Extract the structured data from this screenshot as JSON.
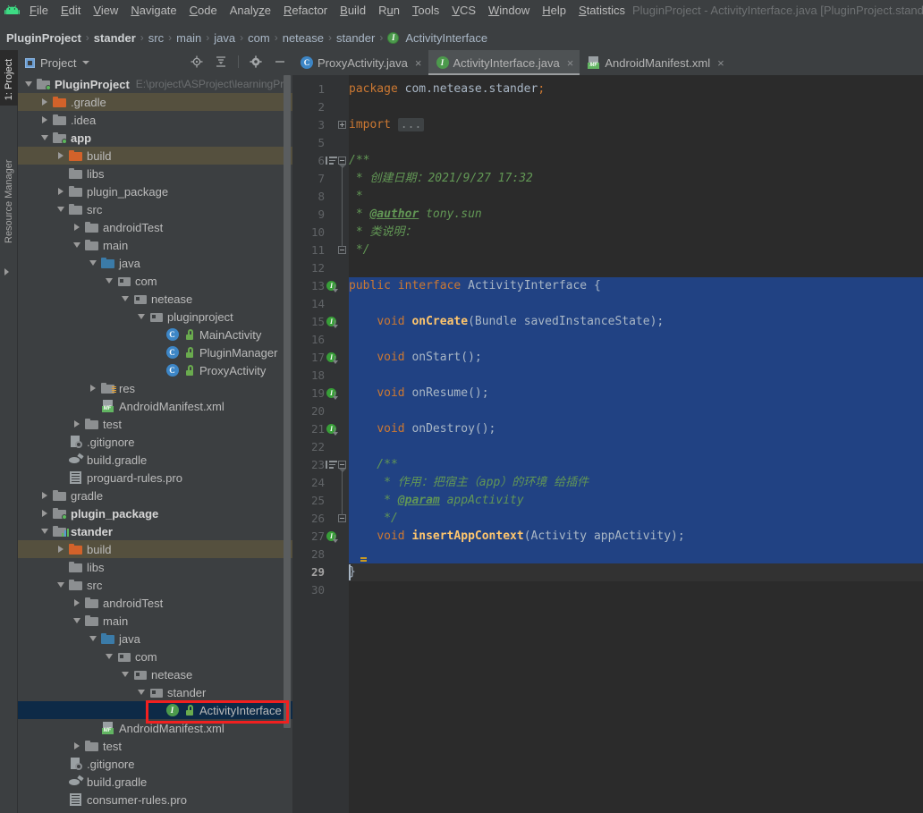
{
  "window": {
    "title": "PluginProject - ActivityInterface.java [PluginProject.stander]"
  },
  "menubar": {
    "logo_icon": "android-logo-icon",
    "items": [
      {
        "label": "File",
        "mnemonic": "F"
      },
      {
        "label": "Edit",
        "mnemonic": "E"
      },
      {
        "label": "View",
        "mnemonic": "V"
      },
      {
        "label": "Navigate",
        "mnemonic": "N"
      },
      {
        "label": "Code",
        "mnemonic": "C"
      },
      {
        "label": "Analyze",
        "mnemonic": "z"
      },
      {
        "label": "Refactor",
        "mnemonic": "R"
      },
      {
        "label": "Build",
        "mnemonic": "B"
      },
      {
        "label": "Run",
        "mnemonic": "u"
      },
      {
        "label": "Tools",
        "mnemonic": "T"
      },
      {
        "label": "VCS",
        "mnemonic": "V"
      },
      {
        "label": "Window",
        "mnemonic": "W"
      },
      {
        "label": "Help",
        "mnemonic": "H"
      },
      {
        "label": "Statistics",
        "mnemonic": "S"
      }
    ]
  },
  "breadcrumb": {
    "items": [
      "PluginProject",
      "stander",
      "src",
      "main",
      "java",
      "com",
      "netease",
      "stander"
    ],
    "leaf": "ActivityInterface",
    "leaf_icon": "interface-icon",
    "separator": "›"
  },
  "left_tool_strip": {
    "tabs": [
      {
        "label": "1: Project",
        "active": true
      },
      {
        "label": "Resource Manager",
        "active": false
      }
    ]
  },
  "project_panel": {
    "title": "Project",
    "dropdown_icon": "chevron-down-icon",
    "toolbar": [
      {
        "name": "locate-icon",
        "label": "Select Opened File"
      },
      {
        "name": "collapse-all-icon",
        "label": "Collapse All"
      },
      {
        "name": "gear-icon",
        "label": "Settings"
      },
      {
        "name": "minimize-icon",
        "label": "Hide"
      }
    ],
    "tree": [
      {
        "indent": 0,
        "arrow": "down",
        "icon": "module-icon",
        "label": "PluginProject",
        "bold": true,
        "path": "E:\\project\\ASProject\\learningPro"
      },
      {
        "indent": 1,
        "arrow": "right",
        "icon": "folder-orange",
        "label": ".gradle",
        "row_highlight": "excluded"
      },
      {
        "indent": 1,
        "arrow": "right",
        "icon": "folder-grey",
        "label": ".idea"
      },
      {
        "indent": 1,
        "arrow": "down",
        "icon": "module-icon",
        "label": "app",
        "bold": true
      },
      {
        "indent": 2,
        "arrow": "right",
        "icon": "folder-orange",
        "label": "build",
        "row_highlight": "excluded"
      },
      {
        "indent": 2,
        "arrow": "none",
        "icon": "folder-grey",
        "label": "libs"
      },
      {
        "indent": 2,
        "arrow": "right",
        "icon": "folder-grey",
        "label": "plugin_package"
      },
      {
        "indent": 2,
        "arrow": "down",
        "icon": "folder-grey",
        "label": "src"
      },
      {
        "indent": 3,
        "arrow": "right",
        "icon": "folder-grey",
        "label": "androidTest"
      },
      {
        "indent": 3,
        "arrow": "down",
        "icon": "folder-grey",
        "label": "main"
      },
      {
        "indent": 4,
        "arrow": "down",
        "icon": "folder-blue",
        "label": "java"
      },
      {
        "indent": 5,
        "arrow": "down",
        "icon": "package-icon",
        "label": "com"
      },
      {
        "indent": 6,
        "arrow": "down",
        "icon": "package-icon",
        "label": "netease"
      },
      {
        "indent": 7,
        "arrow": "down",
        "icon": "package-icon",
        "label": "pluginproject"
      },
      {
        "indent": 8,
        "arrow": "none",
        "icon": "class-icon",
        "label": "MainActivity",
        "badge": "lock-icon"
      },
      {
        "indent": 8,
        "arrow": "none",
        "icon": "class-icon",
        "label": "PluginManager",
        "badge": "lock-icon"
      },
      {
        "indent": 8,
        "arrow": "none",
        "icon": "class-icon",
        "label": "ProxyActivity",
        "badge": "lock-icon"
      },
      {
        "indent": 4,
        "arrow": "right",
        "icon": "folder-res",
        "label": "res"
      },
      {
        "indent": 4,
        "arrow": "none",
        "icon": "manifest-icon",
        "label": "AndroidManifest.xml"
      },
      {
        "indent": 3,
        "arrow": "right",
        "icon": "folder-grey",
        "label": "test"
      },
      {
        "indent": 2,
        "arrow": "none",
        "icon": "gitignore-icon",
        "label": ".gitignore"
      },
      {
        "indent": 2,
        "arrow": "none",
        "icon": "gradle-icon",
        "label": "build.gradle"
      },
      {
        "indent": 2,
        "arrow": "none",
        "icon": "proguard-icon",
        "label": "proguard-rules.pro"
      },
      {
        "indent": 1,
        "arrow": "right",
        "icon": "folder-grey",
        "label": "gradle"
      },
      {
        "indent": 1,
        "arrow": "right",
        "icon": "module-icon",
        "label": "plugin_package",
        "bold": true
      },
      {
        "indent": 1,
        "arrow": "down",
        "icon": "module-lib-icon",
        "label": "stander",
        "bold": true
      },
      {
        "indent": 2,
        "arrow": "right",
        "icon": "folder-orange",
        "label": "build",
        "row_highlight": "excluded"
      },
      {
        "indent": 2,
        "arrow": "none",
        "icon": "folder-grey",
        "label": "libs"
      },
      {
        "indent": 2,
        "arrow": "down",
        "icon": "folder-grey",
        "label": "src"
      },
      {
        "indent": 3,
        "arrow": "right",
        "icon": "folder-grey",
        "label": "androidTest"
      },
      {
        "indent": 3,
        "arrow": "down",
        "icon": "folder-grey",
        "label": "main"
      },
      {
        "indent": 4,
        "arrow": "down",
        "icon": "folder-blue",
        "label": "java"
      },
      {
        "indent": 5,
        "arrow": "down",
        "icon": "package-icon",
        "label": "com"
      },
      {
        "indent": 6,
        "arrow": "down",
        "icon": "package-icon",
        "label": "netease"
      },
      {
        "indent": 7,
        "arrow": "down",
        "icon": "package-icon",
        "label": "stander"
      },
      {
        "indent": 8,
        "arrow": "none",
        "icon": "interface-icon",
        "label": "ActivityInterface",
        "badge": "lock-icon",
        "row_highlight": "selected",
        "annotated": true
      },
      {
        "indent": 4,
        "arrow": "none",
        "icon": "manifest-icon",
        "label": "AndroidManifest.xml"
      },
      {
        "indent": 3,
        "arrow": "right",
        "icon": "folder-grey",
        "label": "test"
      },
      {
        "indent": 2,
        "arrow": "none",
        "icon": "gitignore-icon",
        "label": ".gitignore"
      },
      {
        "indent": 2,
        "arrow": "none",
        "icon": "gradle-icon",
        "label": "build.gradle"
      },
      {
        "indent": 2,
        "arrow": "none",
        "icon": "proguard-icon",
        "label": "consumer-rules.pro"
      }
    ]
  },
  "editor": {
    "tabs": [
      {
        "label": "ProxyActivity.java",
        "icon": "class-icon",
        "active": false,
        "close_icon": "×"
      },
      {
        "label": "ActivityInterface.java",
        "icon": "interface-icon",
        "active": true,
        "close_icon": "×"
      },
      {
        "label": "AndroidManifest.xml",
        "icon": "manifest-icon",
        "active": false,
        "close_icon": "×"
      }
    ],
    "filename": "ActivityInterface.java",
    "first_line": 1,
    "last_line": 30,
    "selection_start_line": 13,
    "selection_end_line": 28,
    "current_line": 29,
    "lines": [
      {
        "n": 1,
        "tokens": [
          {
            "t": "package",
            "c": "kw"
          },
          {
            "t": " ",
            "c": "pl"
          },
          {
            "t": "com.netease.stander",
            "c": "pl"
          },
          {
            "t": ";",
            "c": "sem"
          }
        ]
      },
      {
        "n": 2,
        "tokens": []
      },
      {
        "n": 3,
        "tokens": [
          {
            "t": "import",
            "c": "kw"
          },
          {
            "t": " ",
            "c": "pl"
          },
          {
            "t": "...",
            "c": "fold"
          }
        ],
        "fold": "plus"
      },
      {
        "n": 5,
        "tokens": []
      },
      {
        "n": 6,
        "tokens": [
          {
            "t": "/**",
            "c": "cmt"
          }
        ],
        "gutter": "doc",
        "fold": "start"
      },
      {
        "n": 7,
        "tokens": [
          {
            "t": " * 创建日期：2021/9/27 17:32",
            "c": "cmt"
          }
        ]
      },
      {
        "n": 8,
        "tokens": [
          {
            "t": " *",
            "c": "cmt"
          }
        ]
      },
      {
        "n": 9,
        "tokens": [
          {
            "t": " * ",
            "c": "cmt"
          },
          {
            "t": "@author",
            "c": "cmtt"
          },
          {
            "t": " tony.sun",
            "c": "cmt"
          }
        ]
      },
      {
        "n": 10,
        "tokens": [
          {
            "t": " * 类说明：",
            "c": "cmt"
          }
        ]
      },
      {
        "n": 11,
        "tokens": [
          {
            "t": " */",
            "c": "cmt"
          }
        ],
        "fold": "end"
      },
      {
        "n": 12,
        "tokens": []
      },
      {
        "n": 13,
        "tokens": [
          {
            "t": "public",
            "c": "kw"
          },
          {
            "t": " ",
            "c": "pl"
          },
          {
            "t": "interface",
            "c": "kw"
          },
          {
            "t": " ",
            "c": "pl"
          },
          {
            "t": "ActivityInterface",
            "c": "pl"
          },
          {
            "t": " {",
            "c": "pl"
          }
        ],
        "gutter": "impl"
      },
      {
        "n": 14,
        "tokens": []
      },
      {
        "n": 15,
        "tokens": [
          {
            "t": "    ",
            "c": "pl"
          },
          {
            "t": "void",
            "c": "kw"
          },
          {
            "t": " ",
            "c": "pl"
          },
          {
            "t": "onCreate",
            "c": "mth"
          },
          {
            "t": "(Bundle savedInstanceState);",
            "c": "pl"
          }
        ],
        "gutter": "impl"
      },
      {
        "n": 16,
        "tokens": []
      },
      {
        "n": 17,
        "tokens": [
          {
            "t": "    ",
            "c": "pl"
          },
          {
            "t": "void",
            "c": "kw"
          },
          {
            "t": " ",
            "c": "pl"
          },
          {
            "t": "onStart",
            "c": "mthn"
          },
          {
            "t": "();",
            "c": "pl"
          }
        ],
        "gutter": "impl"
      },
      {
        "n": 18,
        "tokens": []
      },
      {
        "n": 19,
        "tokens": [
          {
            "t": "    ",
            "c": "pl"
          },
          {
            "t": "void",
            "c": "kw"
          },
          {
            "t": " ",
            "c": "pl"
          },
          {
            "t": "onResume",
            "c": "mthn"
          },
          {
            "t": "();",
            "c": "pl"
          }
        ],
        "gutter": "impl"
      },
      {
        "n": 20,
        "tokens": []
      },
      {
        "n": 21,
        "tokens": [
          {
            "t": "    ",
            "c": "pl"
          },
          {
            "t": "void",
            "c": "kw"
          },
          {
            "t": " ",
            "c": "pl"
          },
          {
            "t": "onDestroy",
            "c": "mthn"
          },
          {
            "t": "();",
            "c": "pl"
          }
        ],
        "gutter": "impl"
      },
      {
        "n": 22,
        "tokens": []
      },
      {
        "n": 23,
        "tokens": [
          {
            "t": "    /**",
            "c": "cmt"
          }
        ],
        "gutter": "doc",
        "fold": "start"
      },
      {
        "n": 24,
        "tokens": [
          {
            "t": "     * 作用：把宿主（app）的环境 给插件",
            "c": "cmt"
          }
        ]
      },
      {
        "n": 25,
        "tokens": [
          {
            "t": "     * ",
            "c": "cmt"
          },
          {
            "t": "@param",
            "c": "cmtt"
          },
          {
            "t": " appActivity",
            "c": "cmt"
          }
        ]
      },
      {
        "n": 26,
        "tokens": [
          {
            "t": "     */",
            "c": "cmt"
          }
        ],
        "fold": "end"
      },
      {
        "n": 27,
        "tokens": [
          {
            "t": "    ",
            "c": "pl"
          },
          {
            "t": "void",
            "c": "kw"
          },
          {
            "t": " ",
            "c": "pl"
          },
          {
            "t": "insertAppContext",
            "c": "mth"
          },
          {
            "t": "(Activity appActivity);",
            "c": "pl"
          }
        ],
        "gutter": "impl"
      },
      {
        "n": 28,
        "tokens": [],
        "bulb": true
      },
      {
        "n": 29,
        "tokens": [
          {
            "t": "}",
            "c": "pl"
          }
        ],
        "current": true
      },
      {
        "n": 30,
        "tokens": []
      }
    ]
  },
  "annotation": {
    "color": "#f02020",
    "target": "ActivityInterface"
  },
  "colors": {
    "panel_bg": "#3c3f41",
    "editor_bg": "#2b2b2b",
    "gutter_bg": "#313335",
    "selection_blue": "#214283",
    "tree_selection": "#0d2a47",
    "excluded_row": "#55503e",
    "accent_keyword": "#cc7832",
    "accent_comment": "#629755",
    "accent_method": "#ffc66d",
    "text": "#a9b7c6"
  }
}
